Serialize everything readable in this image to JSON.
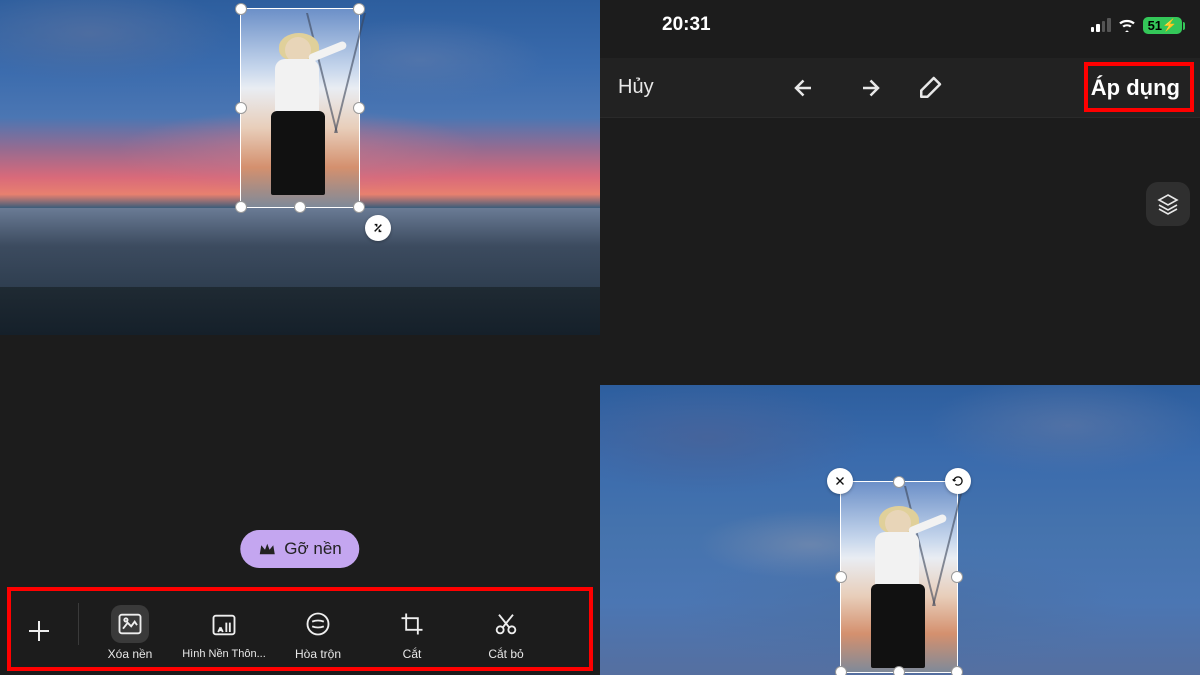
{
  "status": {
    "time": "20:31",
    "battery": "51"
  },
  "top_actions": {
    "cancel": "Hủy",
    "apply": "Áp dụng"
  },
  "remove_bg_button": "Gỡ nền",
  "toolbar": [
    {
      "id": "add",
      "label": ""
    },
    {
      "id": "remove-bg",
      "label": "Xóa nền"
    },
    {
      "id": "smart-bg",
      "label": "Hình Nền Thôn..."
    },
    {
      "id": "blend",
      "label": "Hòa trộn"
    },
    {
      "id": "crop",
      "label": "Cắt"
    },
    {
      "id": "cut-out",
      "label": "Cắt bỏ"
    }
  ]
}
